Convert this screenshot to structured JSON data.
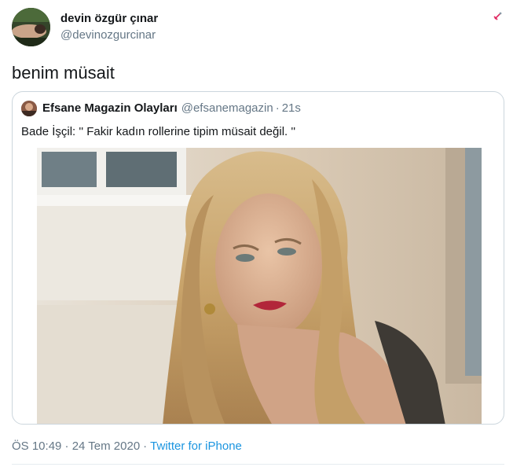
{
  "author": {
    "display_name": "devin özgür çınar",
    "handle": "@devinozgurcinar"
  },
  "tweet": {
    "text": "benim müsait"
  },
  "quoted_tweet": {
    "display_name": "Efsane Magazin Olayları",
    "handle": "@efsanemagazin",
    "separator": "·",
    "time": "21s",
    "text": "Bade İşçil: '' Fakir kadın rollerine tipim müsait değil. ''"
  },
  "meta": {
    "timestamp": "ÖS 10:49 · 24 Tem 2020",
    "separator": "·",
    "source": "Twitter for iPhone"
  },
  "icons": {
    "more": "chevron-down-icon"
  },
  "colors": {
    "secondary_text": "#657786",
    "link": "#1b95e0",
    "border": "#ccd6dd"
  }
}
